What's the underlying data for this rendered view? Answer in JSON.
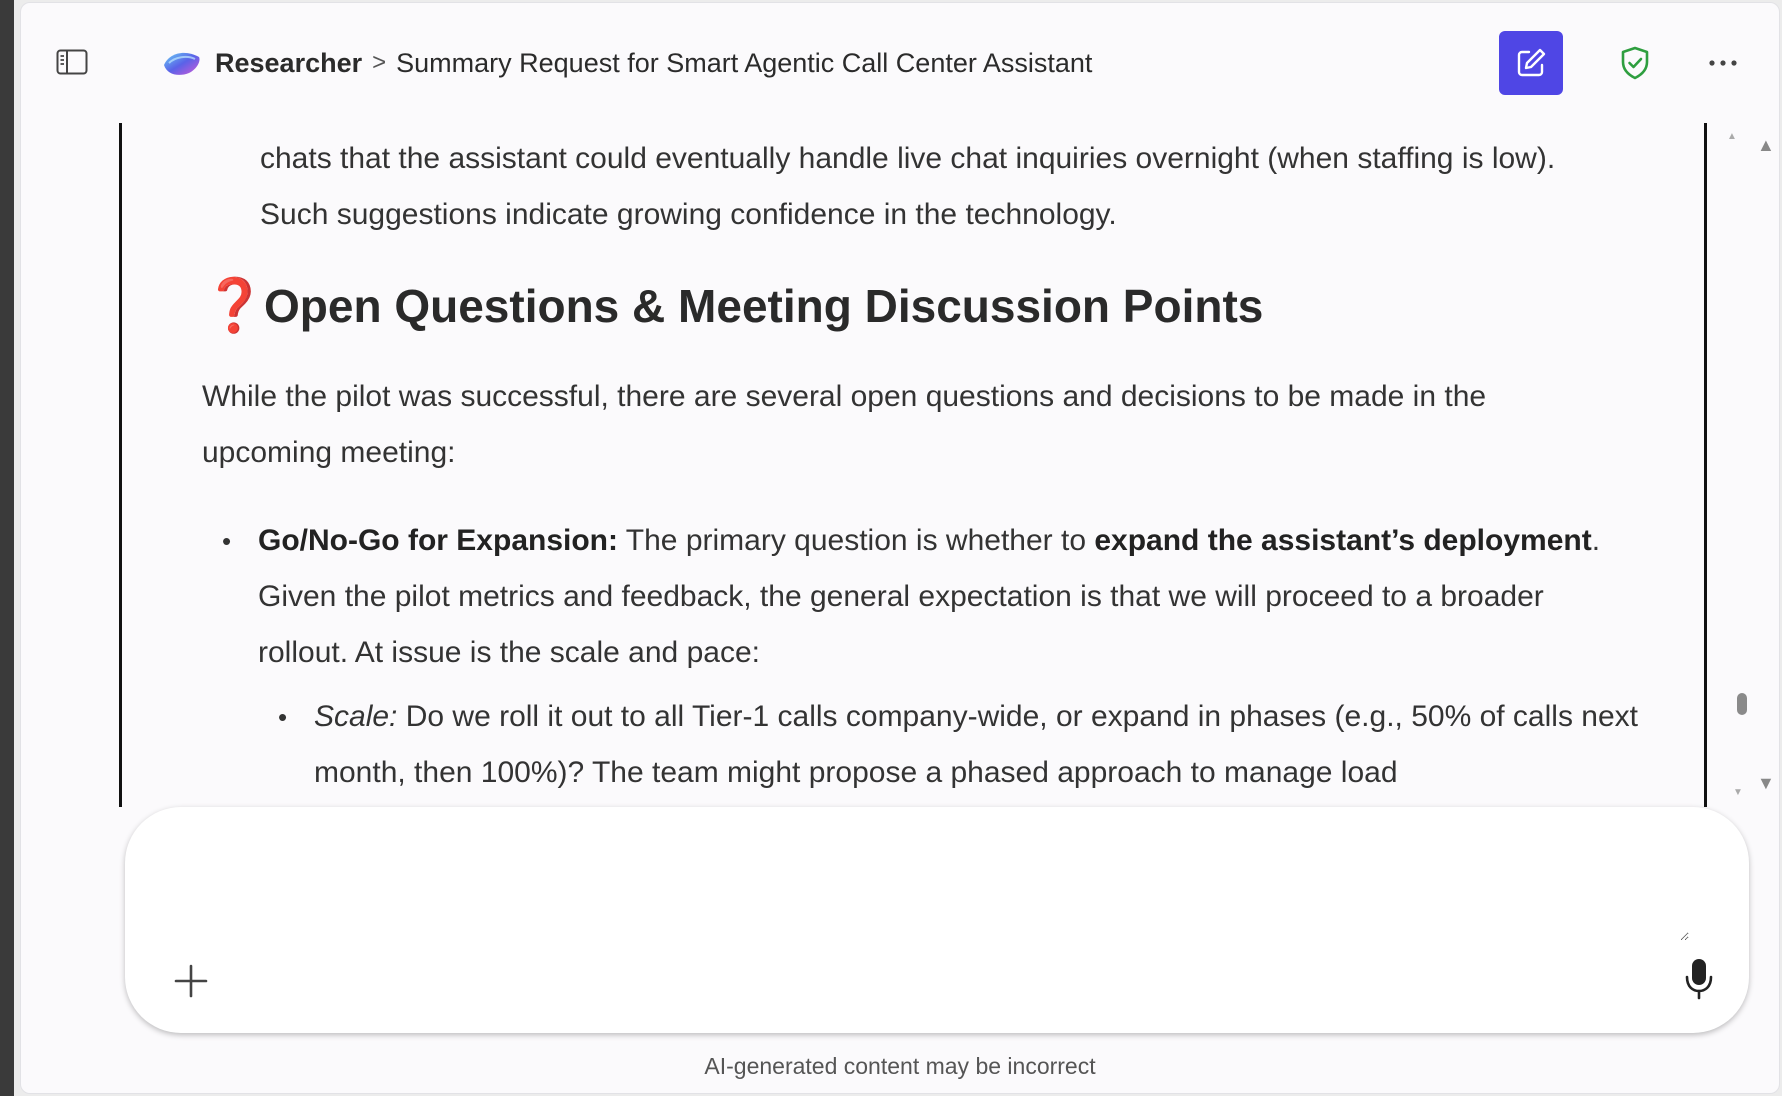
{
  "header": {
    "app_name": "Researcher",
    "separator": ">",
    "conversation_title": "Summary Request for Smart Agentic Call Center Assistant"
  },
  "content": {
    "continued_paragraph": "chats that the assistant could eventually handle live chat inquiries overnight (when staffing is low). Such suggestions indicate growing confidence in the technology.",
    "section_heading": "Open Questions & Meeting Discussion Points",
    "section_icon": "❓",
    "intro_paragraph": "While the pilot was successful, there are several open questions and decisions to be made in the upcoming meeting:",
    "bullet_1": {
      "label": "Go/No-Go for Expansion:",
      "text_a": " The primary question is whether to ",
      "bold_b": "expand the assistant’s deployment",
      "text_c": ". Given the pilot metrics and feedback, the general expectation is that we will proceed to a broader rollout. At issue is the scale and pace:"
    },
    "bullet_2": {
      "label": "Scale:",
      "text": " Do we roll it out to all Tier-1 calls company-wide, or expand in phases (e.g., 50% of calls next month, then 100%)? The team might propose a phased approach to manage load"
    }
  },
  "composer": {
    "placeholder": ""
  },
  "footer": {
    "disclaimer": "AI-generated content may be incorrect"
  },
  "colors": {
    "accent": "#4f46e5",
    "shield": "#2e9e3f",
    "question_mark": "#e02424"
  }
}
